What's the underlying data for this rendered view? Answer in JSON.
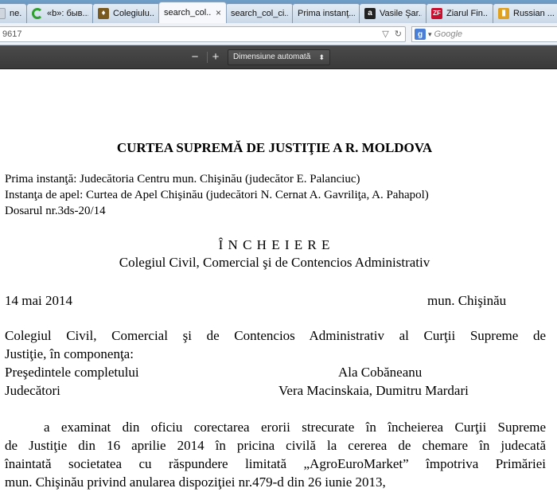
{
  "browser": {
    "tabs": [
      {
        "title": "ne...",
        "favicon": "generic-page-icon",
        "active": false
      },
      {
        "title": "«b»: быв...",
        "favicon": "loading-spinner-icon",
        "active": false
      },
      {
        "title": "Colegiulu...",
        "favicon": "moldova-crest-icon",
        "active": false
      },
      {
        "title": "search_col...",
        "favicon": "generic-page-icon",
        "active": true,
        "close": "×"
      },
      {
        "title": "search_col_ci...",
        "favicon": "generic-page-icon",
        "active": false
      },
      {
        "title": "Prima instanţ...",
        "favicon": "generic-page-icon",
        "active": false
      },
      {
        "title": "Vasile Şar...",
        "favicon": "a-letter-icon",
        "active": false
      },
      {
        "title": "Ziarul Fin...",
        "favicon": "zf-logo-icon",
        "active": false
      },
      {
        "title": "Russian ...",
        "favicon": "book-icon",
        "active": false
      }
    ],
    "url_fragment": "9617",
    "search_engine_letter": "g",
    "search_placeholder": "Google"
  },
  "pdf_toolbar": {
    "zoom_out": "−",
    "zoom_in": "+",
    "zoom_mode": "Dimensiune automată"
  },
  "document": {
    "court_title": "CURTEA SUPREMĂ DE JUSTIŢIE A R. MOLDOVA",
    "first_instance": "Prima instanţă: Judecătoria Centru mun. Chişinău (judecător E. Palanciuc)",
    "appeal_instance": "Instanţa de apel: Curtea de Apel Chişinău  (judecători N. Cernat A. Gavriliţa, A. Pahapol)",
    "case_number": "Dosarul nr.3ds-20/14",
    "doc_type": "Î N C H E I E R E",
    "college": "Colegiul Civil, Comercial şi de Contencios Administrativ",
    "date": "14  mai 2014",
    "place": "mun. Chişinău",
    "composition_line1": "Colegiul Civil, Comercial şi de Contencios Administrativ al Curţii Supreme de",
    "composition_line2": "Justiţie, în componenţa:",
    "president_label": "Preşedintele completului",
    "president_name": "Ala Cobăneanu",
    "judges_label": "Judecători",
    "judges_names": "Vera Macinskaia, Dumitru Mardari",
    "body_line1": "a examinat din oficiu corectarea erorii strecurate în încheierea Curţii Supreme",
    "body_line2": "de Justiţie din 16 aprilie 2014 în pricina civilă la cererea de chemare în judecată",
    "body_line3": "înaintată societatea cu răspundere limitată „AgroEuroMarket” împotriva Primăriei",
    "body_line4": "mun. Chişinău privind anularea dispoziţiei nr.479-d din 26 iunie 2013,"
  }
}
